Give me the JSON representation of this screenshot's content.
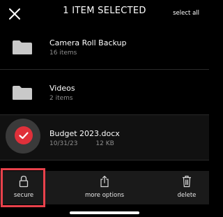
{
  "header": {
    "title": "1 ITEM SELECTED",
    "select_all_label": "select all",
    "close_icon": "close-icon"
  },
  "files": [
    {
      "name": "Camera Roll Backup",
      "meta": "16 items",
      "icon": "folder-icon",
      "selected": false
    },
    {
      "name": "Videos",
      "meta": "2 items",
      "icon": "folder-icon",
      "selected": false
    },
    {
      "name": "Budget 2023.docx",
      "date": "10/31/23",
      "size": "12 KB",
      "icon": "checkmark-icon",
      "selected": true
    }
  ],
  "toolbar": {
    "secure_label": "secure",
    "more_label": "more options",
    "delete_label": "delete"
  },
  "colors": {
    "accent": "#e0303a",
    "highlight_border": "#e8414b",
    "background": "#000000",
    "toolbar_background": "#1a1a1a",
    "meta_text": "#8e8e8e",
    "folder_icon": "#c9c9c9"
  }
}
